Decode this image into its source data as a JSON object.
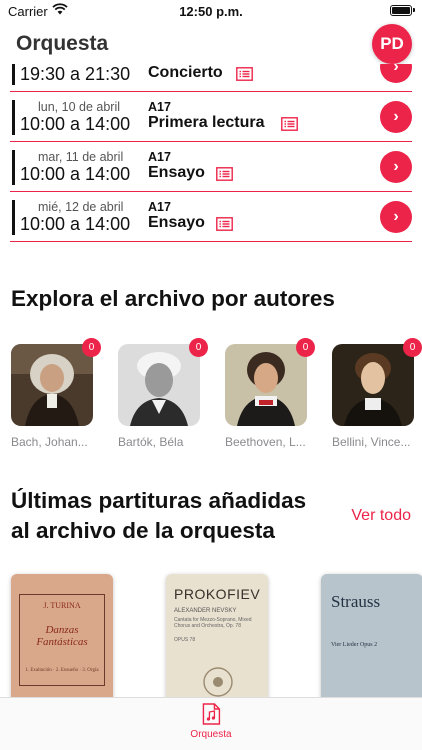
{
  "status": {
    "carrier": "Carrier",
    "time": "12:50 p.m."
  },
  "header": {
    "title": "Orquesta",
    "avatar_initials": "PD"
  },
  "events": [
    {
      "date": "",
      "hours": "19:30 a 21:30",
      "room": "",
      "type": "Concierto"
    },
    {
      "date": "lun, 10 de abril",
      "hours": "10:00 a 14:00",
      "room": "A17",
      "type": "Primera lectura"
    },
    {
      "date": "mar, 11 de abril",
      "hours": "10:00 a 14:00",
      "room": "A17",
      "type": "Ensayo"
    },
    {
      "date": "mié, 12 de abril",
      "hours": "10:00 a 14:00",
      "room": "A17",
      "type": "Ensayo"
    }
  ],
  "authors_section": {
    "title": "Explora el archivo por autores",
    "authors": [
      {
        "name": "Bach, Johan...",
        "count": "0"
      },
      {
        "name": "Bartók, Béla",
        "count": "0"
      },
      {
        "name": "Beethoven, L...",
        "count": "0"
      },
      {
        "name": "Bellini, Vince...",
        "count": "0"
      }
    ]
  },
  "scores_section": {
    "title_line1": "Últimas partituras añadidas",
    "title_line2": "al archivo de la orquesta",
    "see_all": "Ver todo",
    "scores": [
      {
        "composer": "J. TURINA",
        "title": "Danzas Fantásticas",
        "subtitle": "1. Exaltación · 2. Ensueño · 3. Orgía"
      },
      {
        "composer": "PROKOFIEV",
        "subtitle": "ALEXANDER NEVSKY",
        "detail": "Cantata for Mezzo-Soprano, Mixed Chorus and Orchestra, Op. 78",
        "opus": "OPUS 78"
      },
      {
        "composer": "Strauss",
        "subtitle": "Vier Lieder Opus 2"
      }
    ]
  },
  "tabbar": {
    "tab_label": "Orquesta"
  },
  "colors": {
    "accent": "#ed2449"
  }
}
